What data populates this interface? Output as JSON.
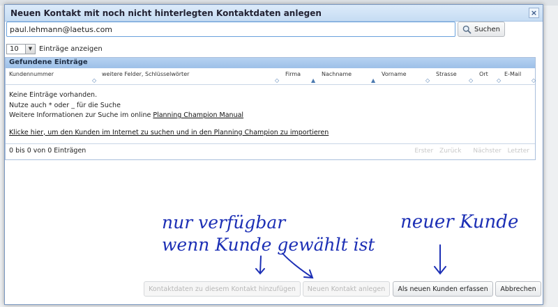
{
  "dialog": {
    "title": "Neuen Kontakt mit noch nicht hinterlegten Kontaktdaten anlegen",
    "close_label": "×"
  },
  "search": {
    "value": "paul.lehmann@laetus.com",
    "button_label": "Suchen"
  },
  "page_size": {
    "value": "10",
    "label": "Einträge anzeigen"
  },
  "table": {
    "title": "Gefundene Einträge",
    "columns": [
      "Kundennummer",
      "weitere Felder, Schlüsselwörter",
      "Firma",
      "Nachname",
      "Vorname",
      "Strasse",
      "Ort",
      "E-Mail"
    ],
    "empty_lines": [
      "Keine Einträge vorhanden.",
      "Nutze auch * oder _ für die Suche"
    ],
    "info_prefix": "Weitere Informationen zur Suche im online ",
    "manual_link": "Planning Champion Manual",
    "import_link": "Klicke hier, um den Kunden im Internet zu suchen und in den Planning Champion zu importieren",
    "info": "0 bis 0 von 0 Einträgen",
    "pager": {
      "first": "Erster",
      "prev": "Zurück",
      "next": "Nächster",
      "last": "Letzter"
    }
  },
  "annotations": {
    "line1": "nur verfügbar",
    "line2": "wenn Kunde gewählt ist",
    "line3": "neuer Kunde",
    "color": "#1c2fb5"
  },
  "buttons": {
    "add_contact_data": "Kontaktdaten zu diesem Kontakt hinzufügen",
    "new_contact": "Neuen Kontakt anlegen",
    "new_customer": "Als neuen Kunden erfassen",
    "cancel": "Abbrechen"
  }
}
